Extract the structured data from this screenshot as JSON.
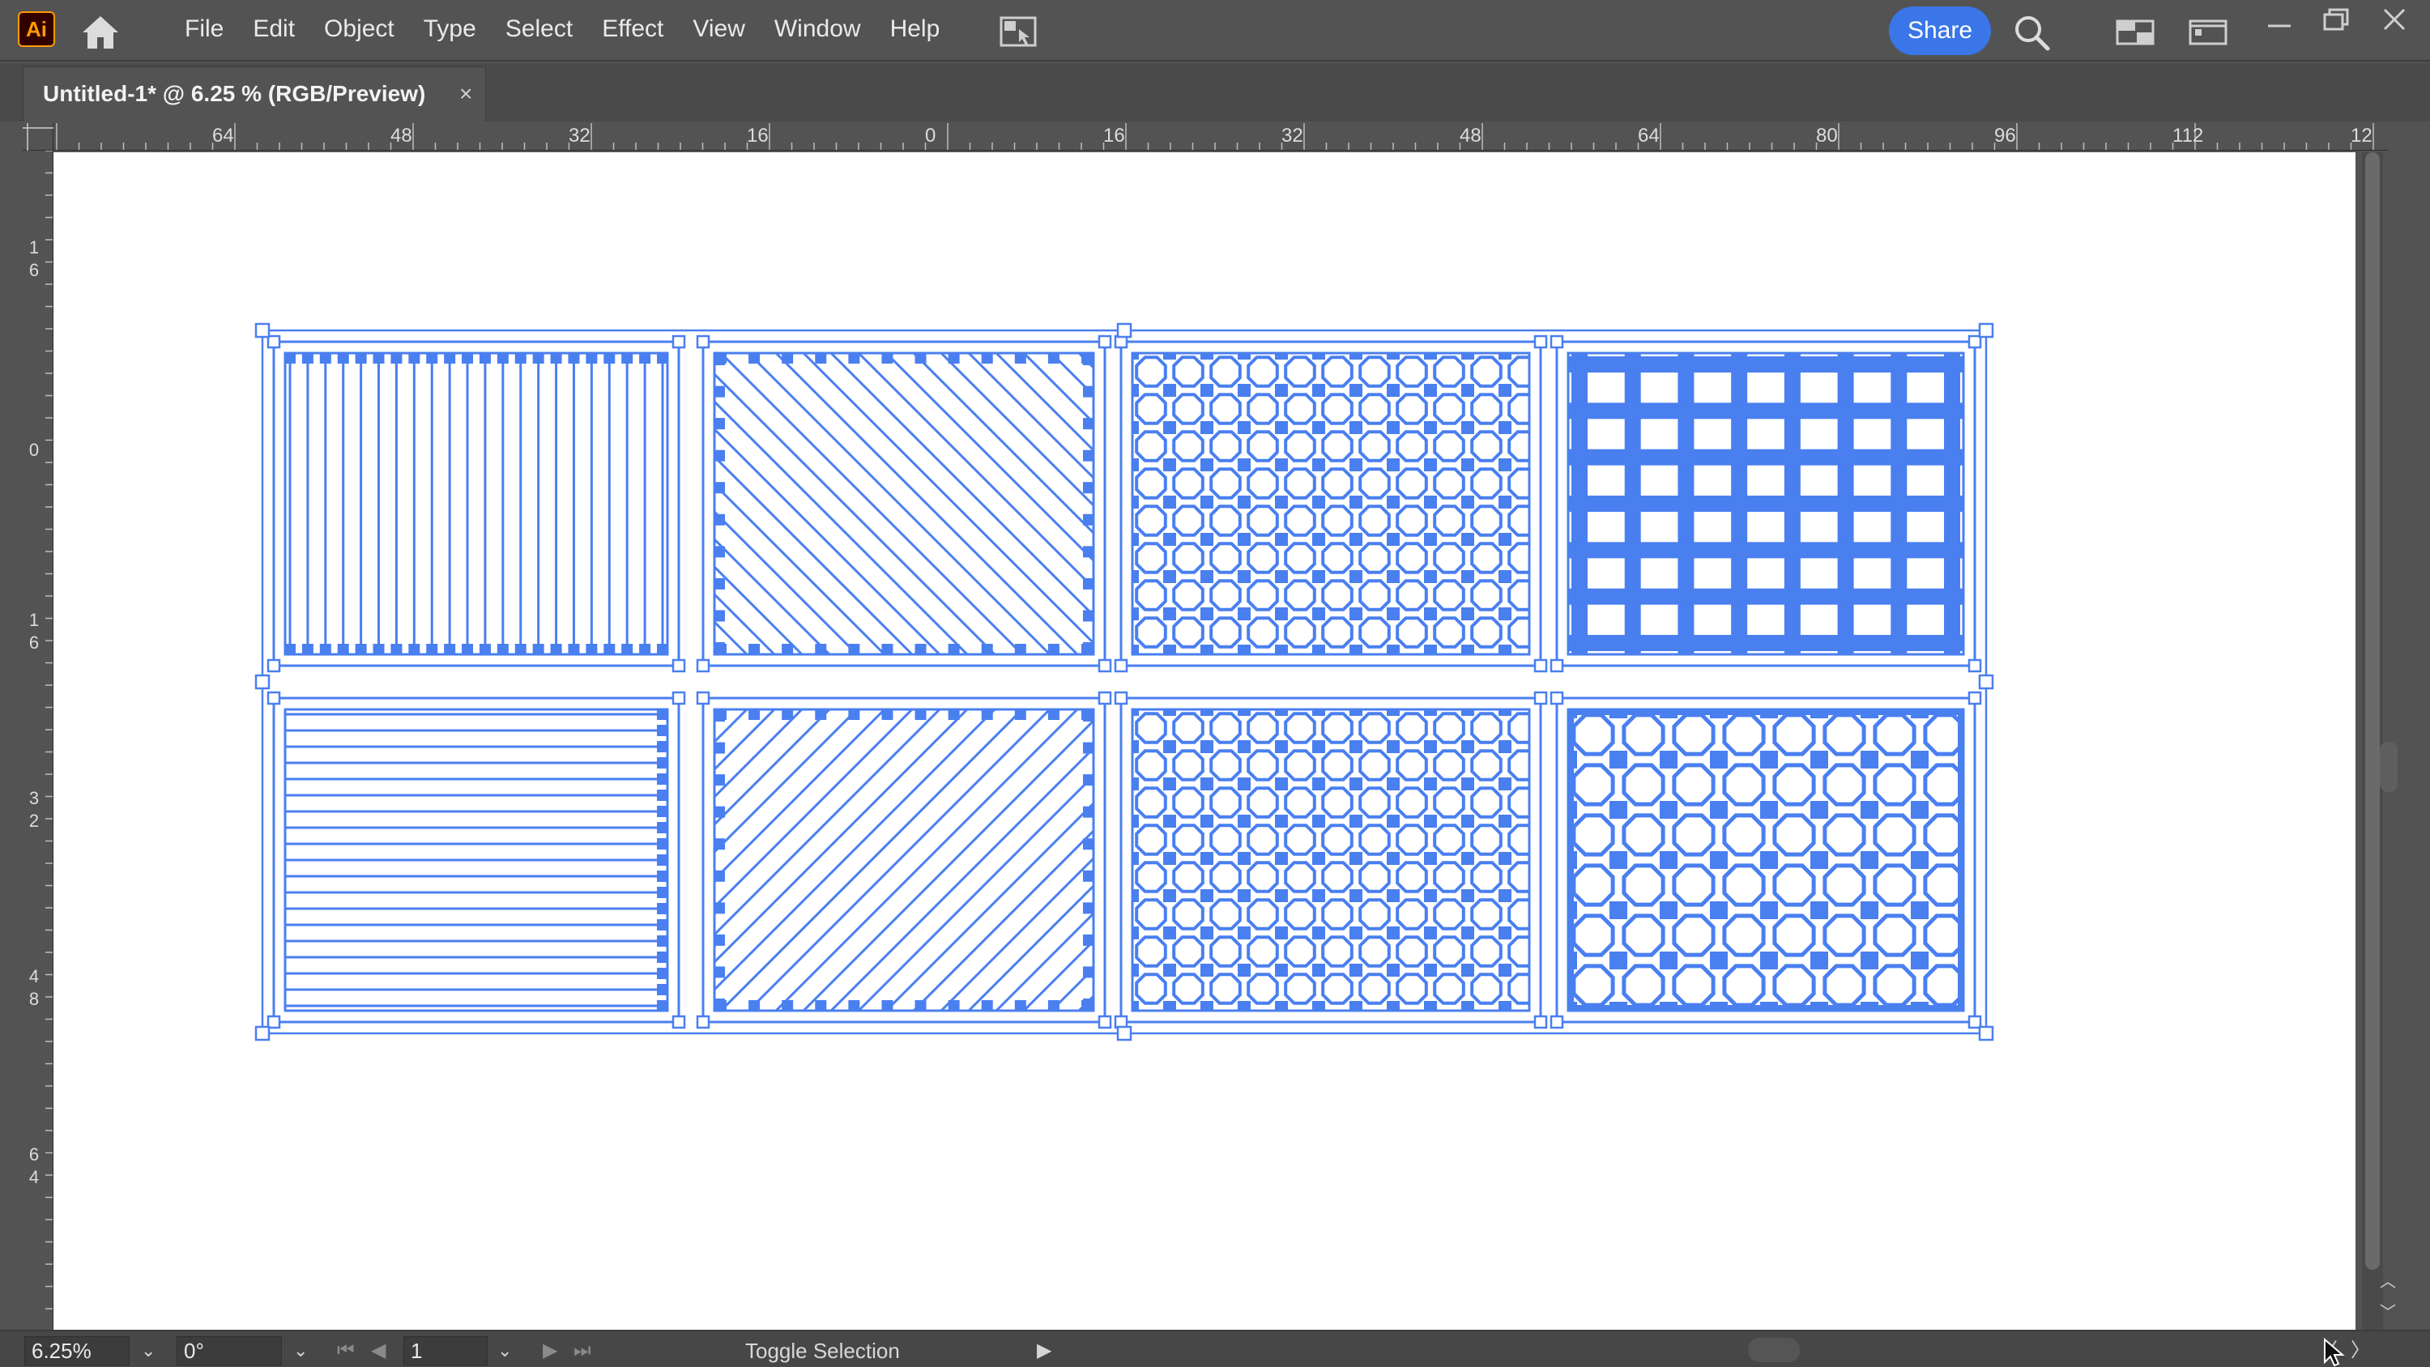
{
  "app": {
    "logo_text": "Ai",
    "menu": [
      "File",
      "Edit",
      "Object",
      "Type",
      "Select",
      "Effect",
      "View",
      "Window",
      "Help"
    ],
    "share_label": "Share",
    "icons": {
      "home": "home-icon",
      "arrange": "arrange-documents-icon",
      "search": "search-icon",
      "workspace": "workspace-switcher-icon",
      "panel": "panel-icon",
      "minimize": "minimize-icon",
      "restore": "restore-icon",
      "close": "close-icon"
    }
  },
  "document": {
    "tab_title": "Untitled-1* @ 6.25 % (RGB/Preview)",
    "tab_close": "×"
  },
  "rulers": {
    "top_labels": [
      "64",
      "48",
      "32",
      "16",
      "0",
      "16",
      "32",
      "48",
      "64",
      "80",
      "96",
      "112",
      "12"
    ],
    "left_labels": [
      "16",
      "0",
      "16",
      "32",
      "48",
      "64"
    ]
  },
  "artwork": {
    "selection_color": "#4a7ff0",
    "tiles": [
      {
        "pattern": "vertical-lines"
      },
      {
        "pattern": "diagonal-lines-down"
      },
      {
        "pattern": "octagon-lattice-dense"
      },
      {
        "pattern": "plaid-grid"
      },
      {
        "pattern": "horizontal-lines"
      },
      {
        "pattern": "diagonal-lines-up"
      },
      {
        "pattern": "octagon-lattice-diagonal"
      },
      {
        "pattern": "octagon-lattice-bold"
      }
    ]
  },
  "status": {
    "zoom": "6.25%",
    "rotation": "0°",
    "artboard": "1",
    "text": "Toggle Selection",
    "chevron": "⌄",
    "first": "⏮",
    "prev": "◀",
    "next": "▶",
    "last": "⏭",
    "play": "▶"
  },
  "scroll": {
    "up": "︿",
    "down": "﹀",
    "left": "〈",
    "right": "〉"
  }
}
